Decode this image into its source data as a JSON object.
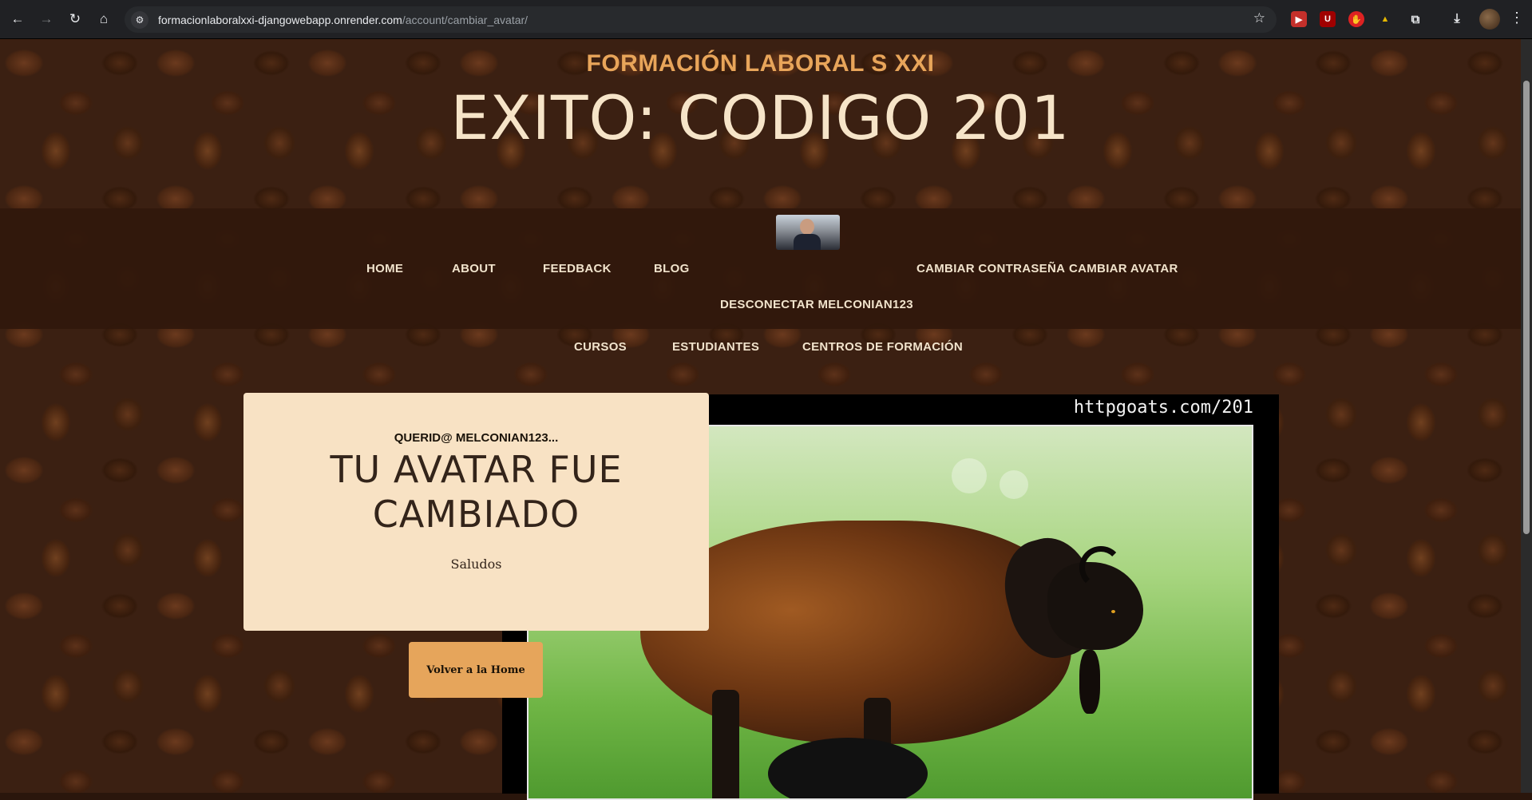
{
  "browser": {
    "url_host": "formacionlaboralxxi-djangowebapp.onrender.com",
    "url_path": "/account/cambiar_avatar/",
    "back_icon": "back-arrow-icon",
    "forward_icon": "forward-arrow-icon",
    "reload_icon": "reload-icon",
    "home_icon": "home-icon",
    "extensions": [
      {
        "name": "youtube-extension-icon",
        "glyph": "▶",
        "color": "#c4302b"
      },
      {
        "name": "ublock-extension-icon",
        "glyph": "U",
        "color": "#a00000"
      },
      {
        "name": "hand-extension-icon",
        "glyph": "✋",
        "color": "#d22"
      },
      {
        "name": "arrow-extension-icon",
        "glyph": "▲",
        "color": "#c9a400"
      }
    ]
  },
  "site": {
    "name": "FORMACIÓN LABORAL S XXI",
    "heading": "EXITO: CODIGO 201",
    "accent_color": "#e8a55a"
  },
  "nav": {
    "home": "HOME",
    "about": "ABOUT",
    "feedback": "FEEDBACK",
    "blog": "BLOG",
    "change_password": "CAMBIAR CONTRASEÑA",
    "change_avatar": "CAMBIAR AVATAR",
    "logout": "DESCONECTAR MELCONIAN123",
    "courses": "CURSOS",
    "students": "ESTUDIANTES",
    "centers": "CENTROS DE FORMACIÓN"
  },
  "goat": {
    "caption": "httpgoats.com/201"
  },
  "message": {
    "greeting": "QUERID@ MELCONIAN123...",
    "title_line1": "TU AVATAR FUE",
    "title_line2": "CAMBIADO",
    "text": "Saludos",
    "button": "Volver a la Home"
  }
}
